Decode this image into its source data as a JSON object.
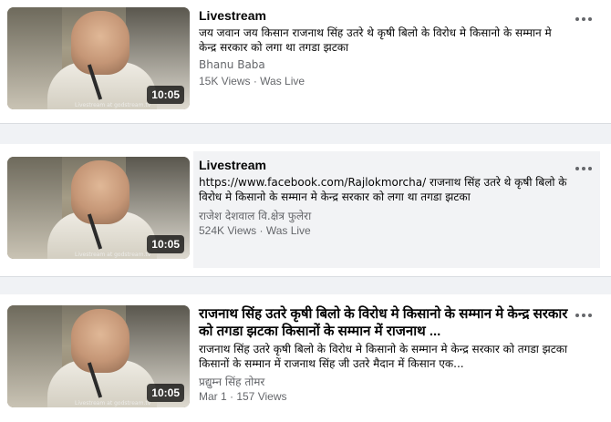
{
  "videos": [
    {
      "title": "Livestream",
      "description": "जय जवान जय किसान राजनाथ सिंह उतरे थे कृषी बिलो के विरोध मे किसानो के सम्मान मे केन्द्र सरकार को लगा था तगडा झटका",
      "author": "Bhanu Baba",
      "meta": "15K Views · Was Live",
      "duration": "10:05"
    },
    {
      "title": "Livestream",
      "description": "https://www.facebook.com/Rajlokmorcha/ राजनाथ सिंह उतरे थे कृषी बिलो के विरोध मे किसानो के सम्मान मे केन्द्र सरकार को लगा था तगडा झटका",
      "author": "राजेश देशवाल वि.क्षेत्र फुलेरा",
      "meta": "524K Views · Was Live",
      "duration": "10:05"
    },
    {
      "title": "राजनाथ सिंह उतरे कृषी बिलो के विरोध मे किसानो के सम्मान मे केन्द्र सरकार को तगडा झटका किसानों के सम्मान में राजनाथ ...",
      "description": "राजनाथ सिंह उतरे कृषी बिलो के विरोध मे किसानो के सम्मान मे केन्द्र सरकार को तगडा झटका किसानों के सम्मान में राजनाथ सिंह जी उतरे मैदान में किसान एक...",
      "author": "प्रद्युम्न सिंह तोमर",
      "meta": "Mar 1 · 157 Views",
      "duration": "10:05"
    }
  ],
  "watermark": "Livestream at godstream.tv",
  "icons": {
    "more": "more-options-icon"
  }
}
